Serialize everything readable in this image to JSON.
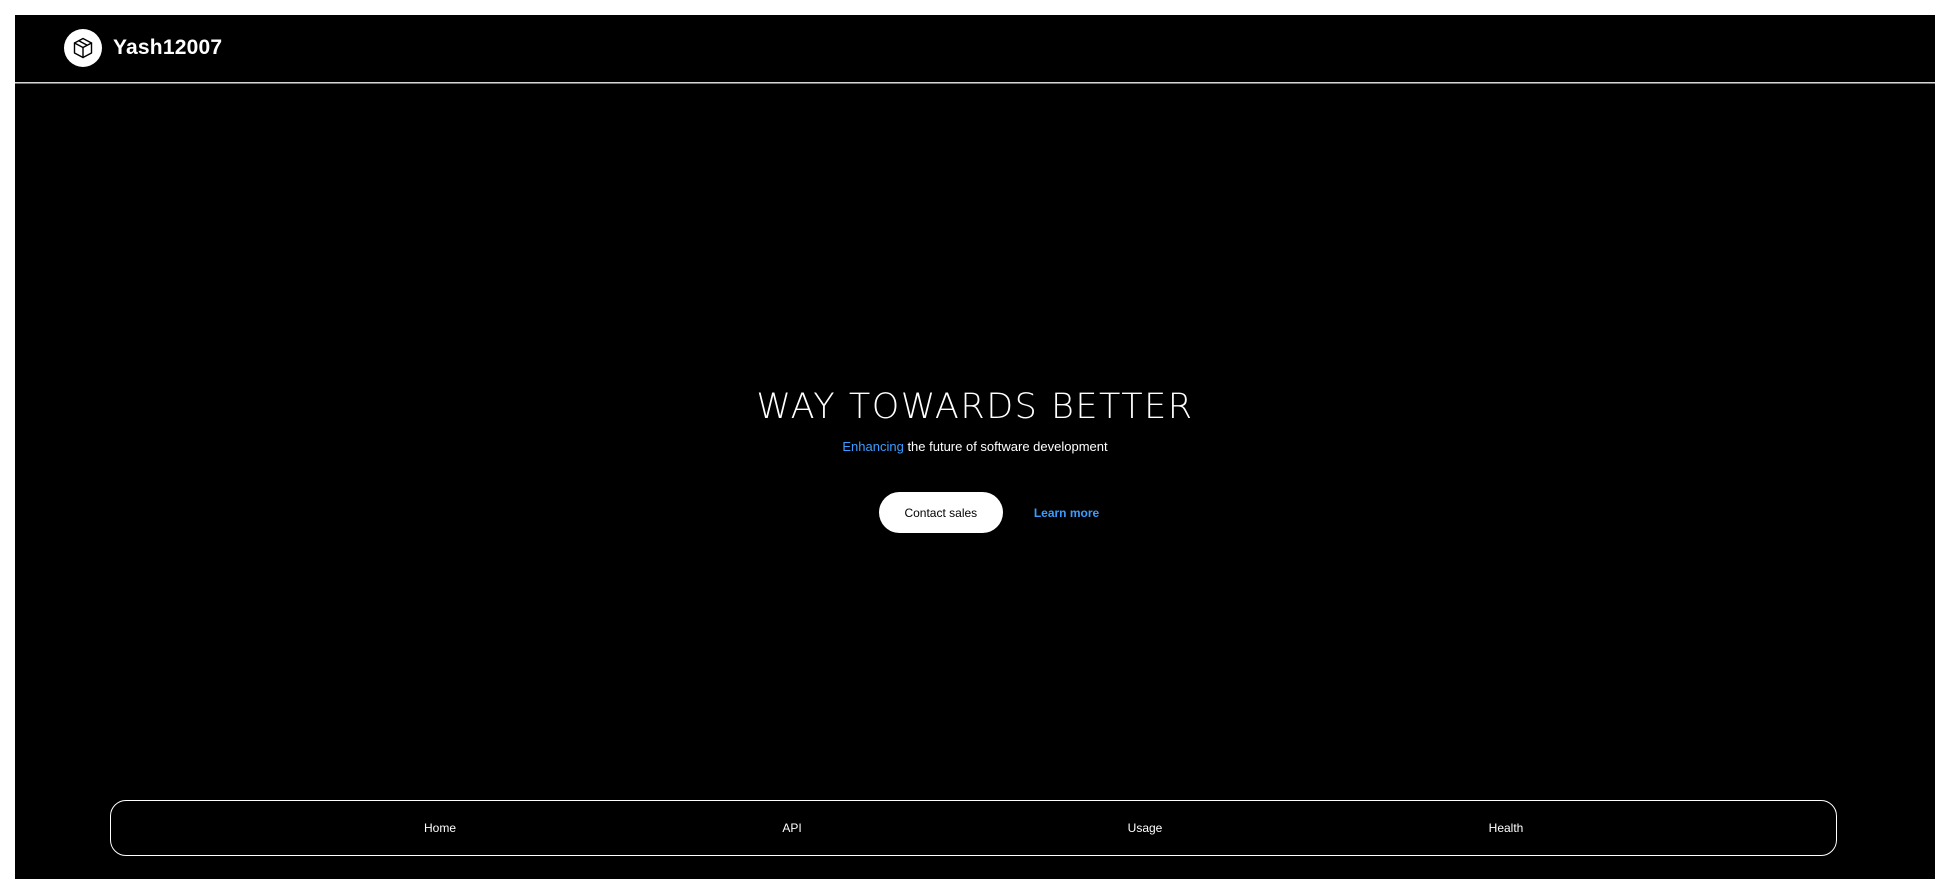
{
  "header": {
    "brand_name": "Yash12007",
    "logo_icon": "cube-icon"
  },
  "hero": {
    "title": "WAY TOWARDS BETTER",
    "subtitle_accent": "Enhancing",
    "subtitle_rest": " the future of software development",
    "contact_label": "Contact sales",
    "learn_label": "Learn more"
  },
  "bottom_nav": {
    "items": [
      {
        "label": "Home"
      },
      {
        "label": "API"
      },
      {
        "label": "Usage"
      },
      {
        "label": "Health"
      }
    ]
  },
  "colors": {
    "background": "#000000",
    "text": "#ffffff",
    "accent": "#3b9cff"
  }
}
